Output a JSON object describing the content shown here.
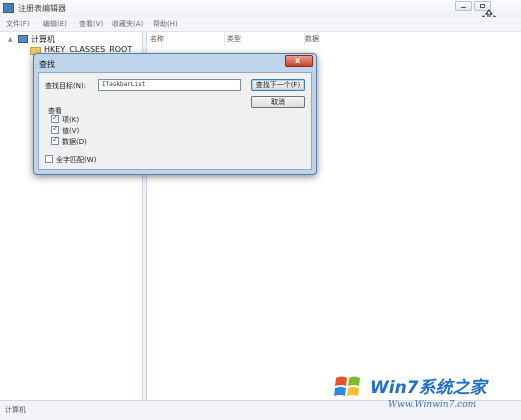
{
  "window": {
    "title": "注册表编辑器"
  },
  "menu": {
    "items": [
      "文件(F)",
      "编辑(E)",
      "查看(V)",
      "收藏夹(A)",
      "帮助(H)"
    ]
  },
  "tree": {
    "root_label": "计算机",
    "root_expander": "▲",
    "first_child": "HKEY_CLASSES_ROOT"
  },
  "list": {
    "columns": [
      "名称",
      "类型",
      "数据"
    ]
  },
  "status_bar": {
    "text": "计算机"
  },
  "find_dialog": {
    "title": "查找",
    "close_glyph": "x",
    "target_label": "查找目标(N):",
    "target_value": "ITaskbarList",
    "find_next_label": "查找下一个(F)",
    "cancel_label": "取消",
    "look_at_label": "查看",
    "options": [
      {
        "label": "项(K)",
        "checked": true
      },
      {
        "label": "值(V)",
        "checked": true
      },
      {
        "label": "数据(D)",
        "checked": true
      }
    ],
    "match_whole": {
      "label": "全字匹配(W)",
      "checked": false
    }
  },
  "watermark": {
    "brand": "Win7系统之家",
    "url": "Www.Winwin7.com"
  },
  "colors": {
    "dialog_frame": "#bfd3ea",
    "close_red": "#c8432b",
    "watermark_blue": "#1f6fcf"
  }
}
